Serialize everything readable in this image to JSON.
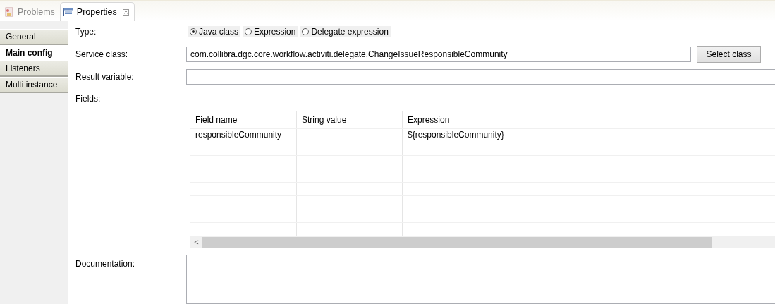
{
  "tabs": [
    {
      "label": "Problems",
      "selected": false,
      "closable": false
    },
    {
      "label": "Properties",
      "selected": true,
      "closable": true
    }
  ],
  "sidebar": {
    "items": [
      {
        "label": "General",
        "selected": false
      },
      {
        "label": "Main config",
        "selected": true
      },
      {
        "label": "Listeners",
        "selected": false
      },
      {
        "label": "Multi instance",
        "selected": false
      }
    ]
  },
  "type": {
    "label": "Type:",
    "options": [
      {
        "label": "Java class",
        "selected": true
      },
      {
        "label": "Expression",
        "selected": false
      },
      {
        "label": "Delegate expression",
        "selected": false
      }
    ]
  },
  "service_class": {
    "label": "Service class:",
    "value": "com.collibra.dgc.core.workflow.activiti.delegate.ChangeIssueResponsibleCommunity",
    "button": "Select class"
  },
  "result_variable": {
    "label": "Result variable:"
  },
  "fields": {
    "label": "Fields:",
    "columns": [
      "Field name",
      "String value",
      "Expression"
    ],
    "rows": [
      {
        "field_name": "responsibleCommunity",
        "expression": "${responsibleCommunity}"
      }
    ],
    "scroll_left": "<"
  },
  "documentation": {
    "label": "Documentation:"
  }
}
